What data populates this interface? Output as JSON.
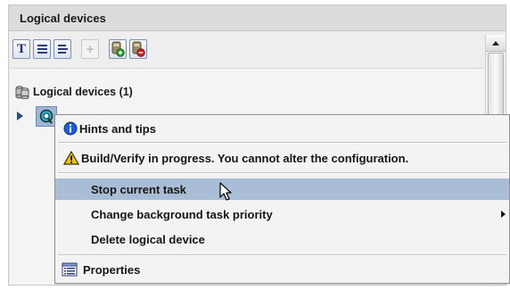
{
  "panel": {
    "title": "Logical devices"
  },
  "toolbar": {
    "buttons": [
      {
        "name": "tree-view-button",
        "glyph": "T"
      },
      {
        "name": "list-view-button",
        "icon": "list-icon"
      },
      {
        "name": "detail-view-button",
        "icon": "detail-list-icon"
      },
      {
        "name": "add-button",
        "icon": "plus-icon",
        "enabled": false
      },
      {
        "name": "add-device-button",
        "icon": "device-add-icon"
      },
      {
        "name": "remove-device-button",
        "icon": "device-remove-icon"
      }
    ]
  },
  "tree": {
    "root_label": "Logical devices (1)",
    "root_icon": "devices-group-icon",
    "selected_node_icon": "logical-device-icon"
  },
  "context_menu": {
    "items": [
      {
        "label": "Hints and tips",
        "icon": "info-icon"
      },
      {
        "label": "Build/Verify in progress.  You cannot alter the configuration.",
        "icon": "warning-icon"
      },
      {
        "label": "Stop current task",
        "hovered": true
      },
      {
        "label": "Change background task priority",
        "has_submenu": true
      },
      {
        "label": "Delete logical device"
      },
      {
        "label": "Properties",
        "icon": "properties-icon"
      }
    ]
  },
  "colors": {
    "menu_hover": "#a9bdd6",
    "selection": "#9fb6d3",
    "info_blue": "#1f5fd1",
    "warning_yellow": "#f5c400"
  }
}
